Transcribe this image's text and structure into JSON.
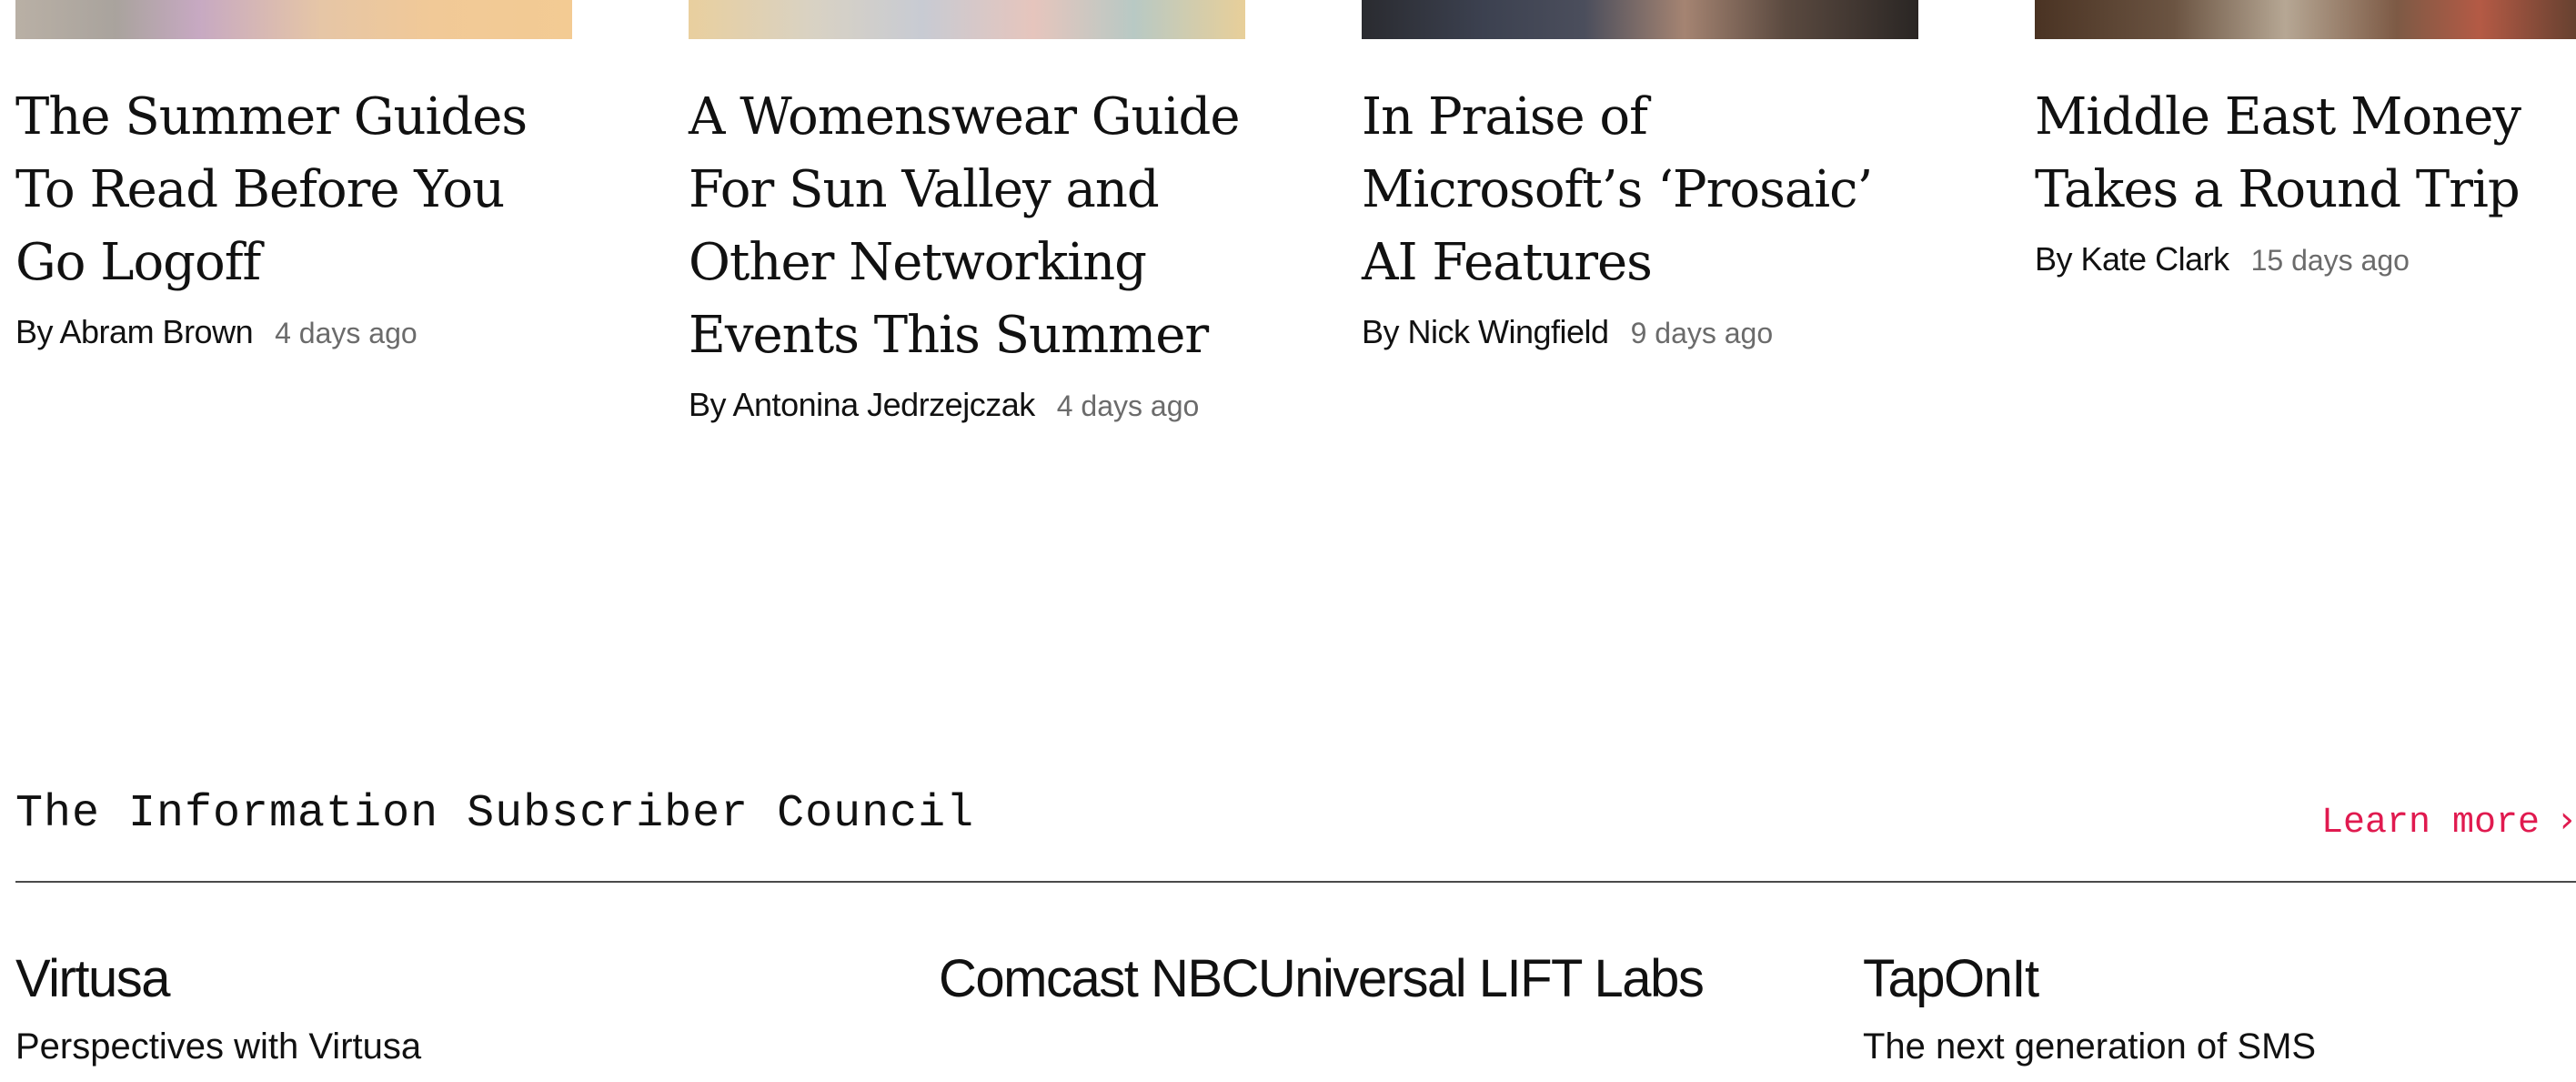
{
  "articles": [
    {
      "headline": "The Summer Guides To Read Before You Go Logoff",
      "author": "By Abram Brown",
      "date": "4 days ago",
      "thumb_gradient": "linear-gradient(90deg, #b9b0a5 0%, #a9a39d 18%, #c7a9c2 33%, #e6c6a6 55%, #f1c997 75%, #f3cb93 100%)"
    },
    {
      "headline": "A Womenswear Guide For Sun Valley and Other Networking Events This Summer",
      "author": "By Antonina Jedrzejczak",
      "date": "4 days ago",
      "thumb_gradient": "linear-gradient(90deg, #e9cf9e 0%, #d9d2c3 22%, #c8cbd3 42%, #e6c5bd 62%, #b8c9c4 80%, #e8cf99 100%)"
    },
    {
      "headline": "In Praise of Microsoft’s ‘Prosaic’ AI Features",
      "author": "By Nick Wingfield",
      "date": "9 days ago",
      "thumb_gradient": "linear-gradient(90deg, #2a2b30 0%, #3c4150 22%, #4b4e5c 40%, #a58472 58%, #5b4a40 76%, #2a2624 100%)"
    },
    {
      "headline": "Middle East Money Takes a Round Trip",
      "author": "By Kate Clark",
      "date": "15 days ago",
      "thumb_gradient": "linear-gradient(90deg, #4a3323 0%, #6b5442 25%, #b6a794 45%, #7d5a45 65%, #b45a45 80%, #5a3d2d 100%)"
    }
  ],
  "council": {
    "title": "The Information Subscriber Council",
    "learn_more": "Learn more",
    "chevron": "›",
    "accent_color": "#e01a4f"
  },
  "sponsors": [
    {
      "name": "Virtusa",
      "description": "Perspectives with Virtusa"
    },
    {
      "name": "Comcast NBCUniversal LIFT Labs",
      "description": ""
    },
    {
      "name": "TapOnIt",
      "description": "The next generation of SMS"
    }
  ]
}
